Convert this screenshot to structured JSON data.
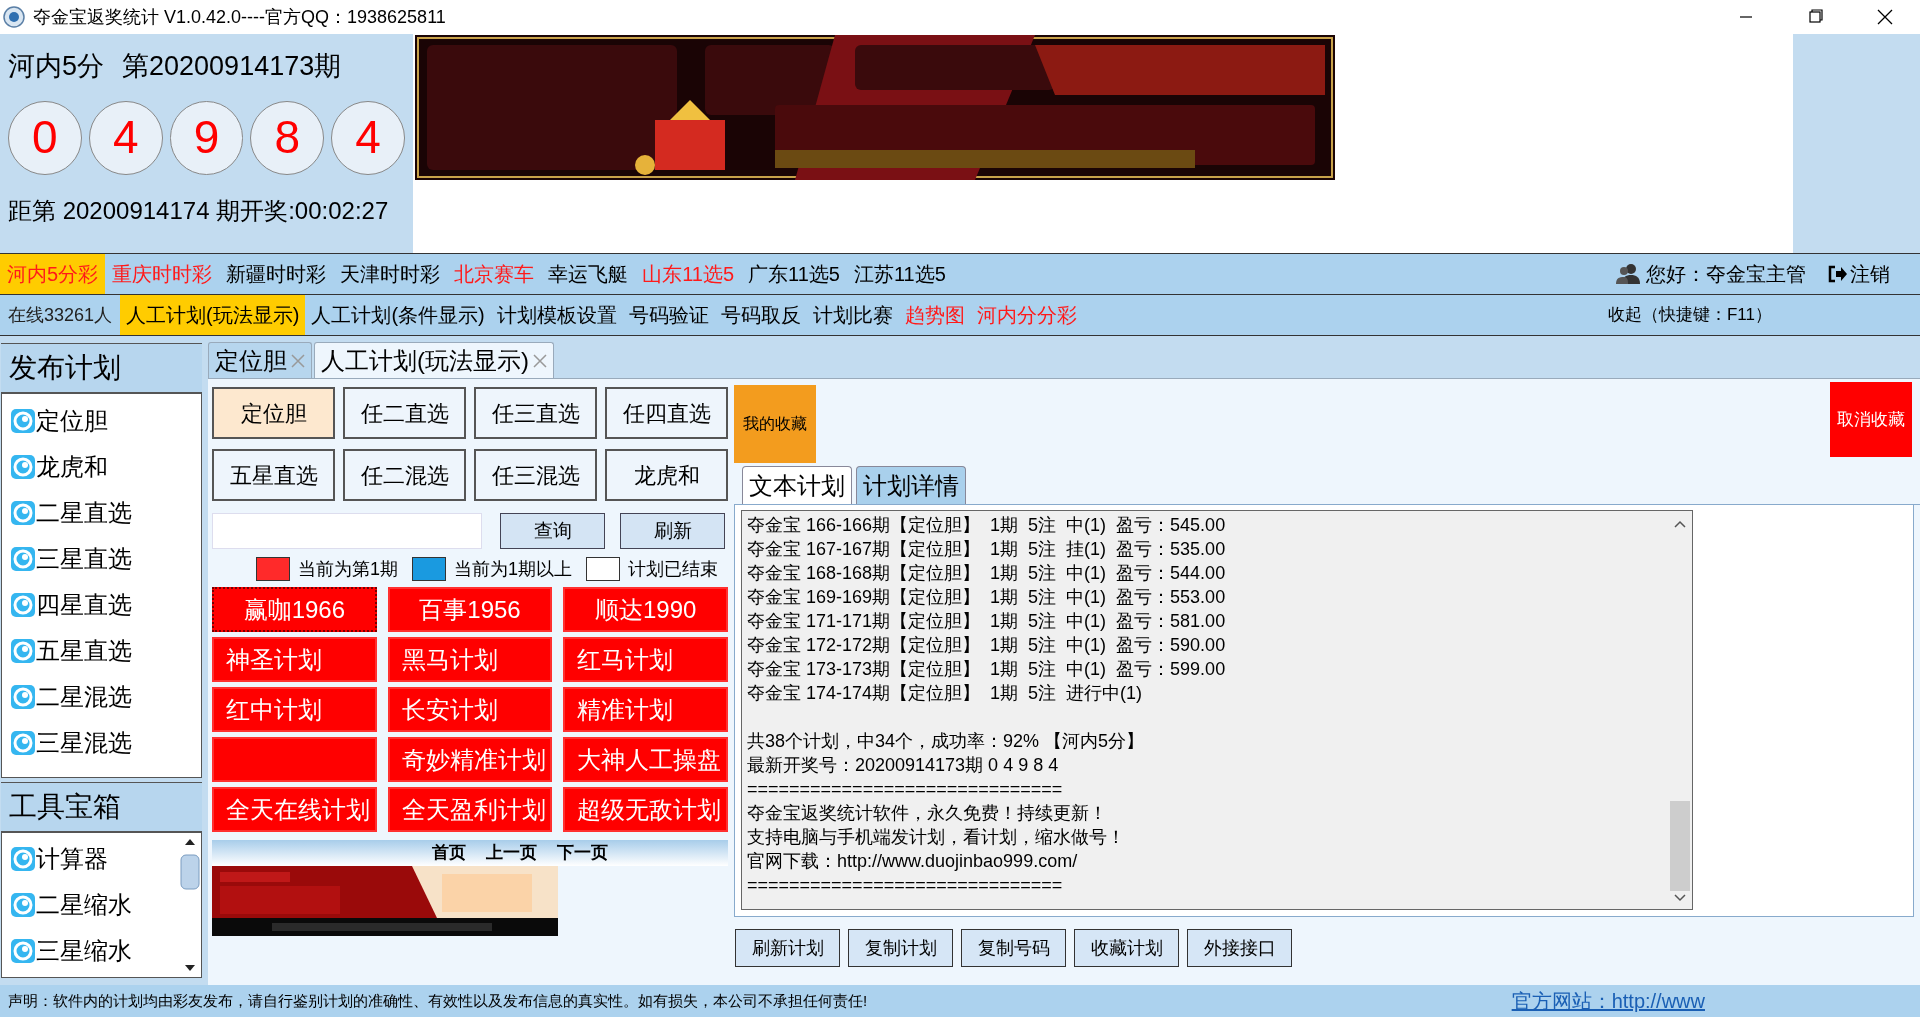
{
  "window": {
    "title": "夺金宝返奖统计  V1.0.42.0----官方QQ：1938625811"
  },
  "draw": {
    "game": "河内5分",
    "period": "第20200914173期",
    "balls": [
      "0",
      "4",
      "9",
      "8",
      "4"
    ],
    "countdown": "距第 20200914174 期开奖:00:02:27"
  },
  "lottery_tabs": [
    {
      "label": "河内5分彩",
      "selected": true,
      "hot": true
    },
    {
      "label": "重庆时时彩",
      "selected": false,
      "hot": true
    },
    {
      "label": "新疆时时彩",
      "selected": false,
      "hot": false
    },
    {
      "label": "天津时时彩",
      "selected": false,
      "hot": false
    },
    {
      "label": "北京赛车",
      "selected": false,
      "hot": true
    },
    {
      "label": "幸运飞艇",
      "selected": false,
      "hot": false
    },
    {
      "label": "山东11选5",
      "selected": false,
      "hot": true
    },
    {
      "label": "广东11选5",
      "selected": false,
      "hot": false
    },
    {
      "label": "江苏11选5",
      "selected": false,
      "hot": false
    }
  ],
  "user": {
    "greeting": "您好：夺金宝主管",
    "logout": "注销"
  },
  "online": "在线33261人",
  "menu": [
    {
      "label": "人工计划(玩法显示)",
      "selected": true,
      "hot": false
    },
    {
      "label": "人工计划(条件显示)",
      "selected": false,
      "hot": false
    },
    {
      "label": "计划模板设置",
      "selected": false,
      "hot": false
    },
    {
      "label": "号码验证",
      "selected": false,
      "hot": false
    },
    {
      "label": "号码取反",
      "selected": false,
      "hot": false
    },
    {
      "label": "计划比赛",
      "selected": false,
      "hot": false
    },
    {
      "label": "趋势图",
      "selected": false,
      "hot": true
    },
    {
      "label": "河内分分彩",
      "selected": false,
      "hot": true
    }
  ],
  "collapse": "收起（快捷键：F11）",
  "sidebar": {
    "publish_title": "发布计划",
    "publish_items": [
      "定位胆",
      "龙虎和",
      "二星直选",
      "三星直选",
      "四星直选",
      "五星直选",
      "二星混选",
      "三星混选"
    ],
    "tools_title": "工具宝箱",
    "tools_items": [
      "计算器",
      "二星缩水",
      "三星缩水"
    ]
  },
  "doc_tabs": [
    {
      "label": "定位胆",
      "selected": false
    },
    {
      "label": "人工计划(玩法显示)",
      "selected": true
    }
  ],
  "play_buttons": [
    {
      "label": "定位胆",
      "selected": true
    },
    {
      "label": "任二直选",
      "selected": false
    },
    {
      "label": "任三直选",
      "selected": false
    },
    {
      "label": "任四直选",
      "selected": false
    },
    {
      "label": "五星直选",
      "selected": false
    },
    {
      "label": "任二混选",
      "selected": false
    },
    {
      "label": "任三混选",
      "selected": false
    },
    {
      "label": "龙虎和",
      "selected": false
    }
  ],
  "search": {
    "query": "查询",
    "refresh": "刷新"
  },
  "legend": [
    {
      "color": "#ff2a2a",
      "label": "当前为第1期"
    },
    {
      "color": "#1a9ae0",
      "label": "当前为1期以上"
    },
    {
      "color": "#ffffff",
      "label": "计划已结束"
    }
  ],
  "plans": [
    {
      "label": "赢咖1966",
      "focused": true,
      "centered": true
    },
    {
      "label": "百事1956",
      "focused": false,
      "centered": true
    },
    {
      "label": "顺达1990",
      "focused": false,
      "centered": true
    },
    {
      "label": "神圣计划",
      "focused": false,
      "centered": false
    },
    {
      "label": "黑马计划",
      "focused": false,
      "centered": false
    },
    {
      "label": "红马计划",
      "focused": false,
      "centered": false
    },
    {
      "label": "红中计划",
      "focused": false,
      "centered": false
    },
    {
      "label": "长安计划",
      "focused": false,
      "centered": false
    },
    {
      "label": "精准计划",
      "focused": false,
      "centered": false
    },
    {
      "focused": false
    },
    {
      "label": "奇妙精准计划",
      "focused": false,
      "centered": false
    },
    {
      "label": "大神人工操盘",
      "focused": false,
      "centered": false
    },
    {
      "label": "全天在线计划",
      "focused": false,
      "centered": false
    },
    {
      "label": "全天盈利计划",
      "focused": false,
      "centered": false
    },
    {
      "label": "超级无敌计划",
      "focused": false,
      "centered": false
    }
  ],
  "ad_nav": [
    "首页",
    "上一页",
    "下一页"
  ],
  "favorites": {
    "mine": "我的收藏",
    "cancel": "取消收藏"
  },
  "view_tabs": [
    {
      "label": "文本计划",
      "selected": true
    },
    {
      "label": "计划详情",
      "selected": false
    }
  ],
  "plan_text": {
    "records": [
      "夺金宝 166-166期【定位胆】  1期  5注  中(1)  盈亏：545.00",
      "夺金宝 167-167期【定位胆】  1期  5注  挂(1)  盈亏：535.00",
      "夺金宝 168-168期【定位胆】  1期  5注  中(1)  盈亏：544.00",
      "夺金宝 169-169期【定位胆】  1期  5注  中(1)  盈亏：553.00",
      "夺金宝 171-171期【定位胆】  1期  5注  中(1)  盈亏：581.00",
      "夺金宝 172-172期【定位胆】  1期  5注  中(1)  盈亏：590.00",
      "夺金宝 173-173期【定位胆】  1期  5注  中(1)  盈亏：599.00",
      "夺金宝 174-174期【定位胆】  1期  5注  进行中(1)"
    ],
    "summary": [
      "共38个计划，中34个，成功率：92% 【河内5分】",
      "最新开奖号：20200914173期 0 4 9 8 4",
      "==============================",
      "夺金宝返奖统计软件，永久免费！持续更新！",
      "支持电脑与手机端发计划，看计划，缩水做号！",
      "官网下载：http://www.duojinbao999.com/",
      "=============================="
    ]
  },
  "actions": [
    "刷新计划",
    "复制计划",
    "复制号码",
    "收藏计划",
    "外接接口"
  ],
  "status_bar": {
    "disclaimer": "声明：软件内的计划均由彩友发布，请自行鉴别计划的准确性、有效性以及发布信息的真实性。如有损失，本公司不承担任何责任!",
    "link": "官方网站：http://www"
  }
}
